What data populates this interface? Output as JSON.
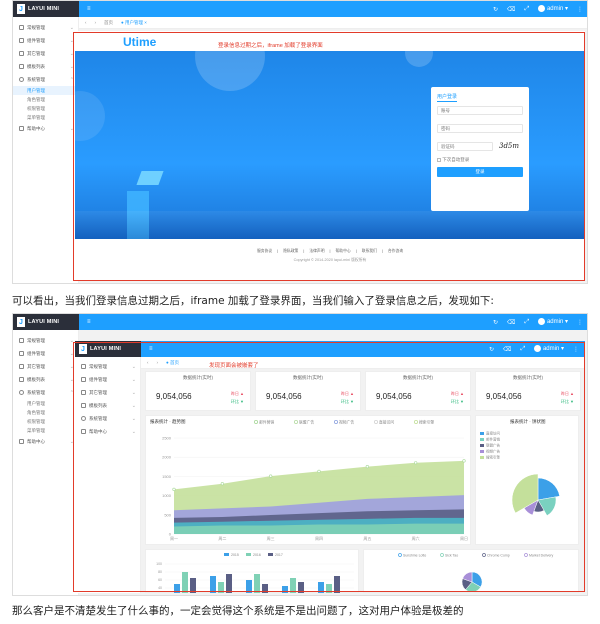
{
  "app": {
    "logo_letter": "J",
    "title": "LAYUI MINI",
    "user": "admin",
    "top_icons": [
      "refresh-icon",
      "clear-icon",
      "fullscreen-icon",
      "user-icon",
      "more-icon"
    ]
  },
  "sidebar": {
    "items": [
      {
        "label": "常规管理"
      },
      {
        "label": "组件管理"
      },
      {
        "label": "其它管理"
      },
      {
        "label": "模板列表"
      },
      {
        "label": "系统管理"
      }
    ],
    "subitems": [
      {
        "label": "用户管理"
      },
      {
        "label": "角色管理"
      },
      {
        "label": "权限管理"
      },
      {
        "label": "菜单管理"
      }
    ],
    "last_item": "帮助中心"
  },
  "tabs": {
    "first": {
      "back": "‹",
      "forward": "›",
      "home": "首页",
      "current": "用户管理"
    },
    "second": {
      "back": "‹",
      "forward": "›",
      "current": "首页"
    }
  },
  "login": {
    "brand": "Utime",
    "note": "登录信息过期之后，iframe 加载了登录界面",
    "card_title": "用户登录",
    "username_placeholder": "账号",
    "password_placeholder": "密码",
    "captcha_placeholder": "验证码",
    "captcha_text": "3d5m",
    "remember": "下次自动登录",
    "submit": "登录",
    "footer_links": [
      "服务协议",
      "隐私政策",
      "法律声明",
      "帮助中心",
      "联系我们",
      "合作咨询"
    ],
    "copyright": "Copyright © 2014-2020 layui-mini 版权所有"
  },
  "caption1": "可以看出，当我们登录信息过期之后，iframe 加载了登录界面，当我们输入了登录信息之后，发现如下:",
  "dashboard": {
    "note": "发现页面会被嵌套了",
    "stat_title": "数据统计(实时)",
    "stat_value": "9,054,056",
    "stat_side_1": "昨日",
    "stat_side_2": "环比",
    "stats_count": 4,
    "chart1_title": "报表统计 · 趋势图",
    "chart2_title": "报表统计 · 饼状图",
    "legend1": [
      "邮件营销",
      "联盟广告",
      "视频广告",
      "直接访问",
      "搜索引擎"
    ],
    "legend2": [
      "直接访问",
      "邮件营销",
      "联盟广告",
      "视频广告",
      "搜索引擎"
    ],
    "x_ticks": [
      "周一",
      "周二",
      "周三",
      "周四",
      "周五",
      "周六",
      "周日"
    ],
    "y_ticks": [
      "2500",
      "2000",
      "1500",
      "1000",
      "500",
      "0"
    ],
    "bar_legend": [
      "2015",
      "2016",
      "2017"
    ],
    "bar_y_ticks": [
      "100",
      "80",
      "60",
      "40"
    ],
    "pie2_legend": [
      "Sunshine Lotte",
      "Sick Tao",
      "Chrome Comp",
      "Market Delivery"
    ]
  },
  "caption2": "那么客户是不清楚发生了什么事的，一定会觉得这个系统是不是出问题了，这对用户体验是极差的"
}
